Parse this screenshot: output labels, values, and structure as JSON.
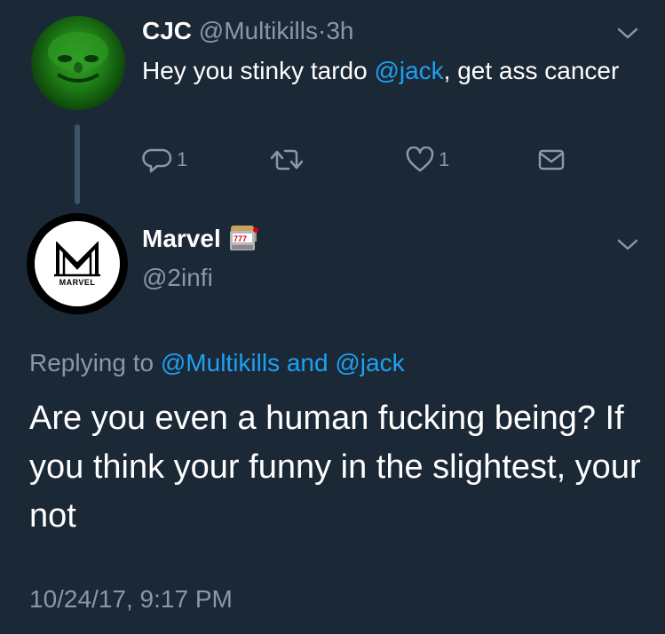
{
  "tweet1": {
    "name": "CJC",
    "handle": "@Multikills",
    "separator": "·",
    "time": "3h",
    "text_before": "Hey you stinky tardo ",
    "mention": "@jack",
    "text_after": ", get ass cancer",
    "reply_count": "1",
    "like_count": "1"
  },
  "tweet2": {
    "name": "Marvel",
    "name_emoji": "slot-machine-icon",
    "handle": "@2infi",
    "avatar_logo_text": "MARVEL",
    "replying_prefix": "Replying to ",
    "replying_user1": "@Multikills",
    "replying_and": " and ",
    "replying_user2": "@jack",
    "text": "Are you even a human fucking being? If you think your funny in the slightest, your not",
    "timestamp": "10/24/17, 9:17 PM"
  },
  "colors": {
    "background": "#1b2836",
    "text": "#ffffff",
    "muted": "#8899a6",
    "link": "#1da1f2"
  }
}
